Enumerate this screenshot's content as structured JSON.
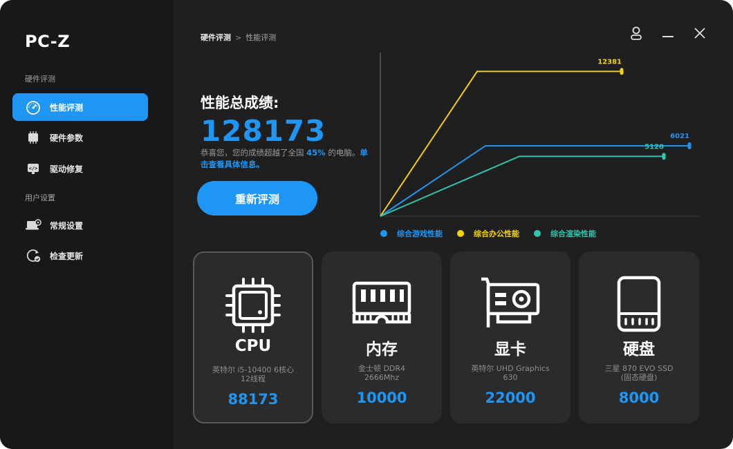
{
  "app": {
    "title": "PC-Z"
  },
  "sidebar": {
    "section_hardware": "硬件评测",
    "section_user": "用户设置",
    "items": [
      {
        "label": "性能评测",
        "icon": "speedometer-icon",
        "active": true
      },
      {
        "label": "硬件参数",
        "icon": "chip-icon",
        "active": false
      },
      {
        "label": "驱动修复",
        "icon": "driver-icon",
        "active": false
      },
      {
        "label": "常规设置",
        "icon": "laptop-settings-icon",
        "active": false
      },
      {
        "label": "检查更新",
        "icon": "refresh-check-icon",
        "active": false
      }
    ]
  },
  "breadcrumb": {
    "level1": "硬件评测",
    "separator": ">",
    "level2": "性能评测"
  },
  "header_icons": [
    "user-icon",
    "minimize-icon",
    "close-icon"
  ],
  "score": {
    "title": "性能总成绩:",
    "value": "128173",
    "desc_prefix": "恭喜您，您的成绩超越了全国 ",
    "percent": "45%",
    "desc_middle": " 的电脑。",
    "desc_link": "单击查看具体信息。",
    "retest_label": "重新评测"
  },
  "colors": {
    "accent": "#1e96f5",
    "office": "#f5d10f",
    "render": "#2ec7b0"
  },
  "chart_data": {
    "type": "line",
    "title": "",
    "xlabel": "",
    "ylabel": "",
    "series": [
      {
        "name": "综合游戏性能",
        "color": "#1e96f5",
        "values": [
          0,
          6021,
          6021
        ],
        "end_label": "6021"
      },
      {
        "name": "综合办公性能",
        "color": "#f5d10f",
        "values": [
          0,
          12381,
          12381
        ],
        "end_label": "12381"
      },
      {
        "name": "综合渲染性能",
        "color": "#2ec7b0",
        "values": [
          0,
          5120,
          5120
        ],
        "end_label": "5120"
      }
    ],
    "ylim": [
      0,
      14000
    ],
    "grid": false,
    "legend": "bottom"
  },
  "cards": [
    {
      "name": "CPU",
      "icon": "cpu-icon",
      "desc_line1": "英特尔 i5-10400 6核心",
      "desc_line2": "12线程",
      "score": "88173",
      "selected": true
    },
    {
      "name": "内存",
      "icon": "memory-icon",
      "desc_line1": "金士顿 DDR4",
      "desc_line2": "2666Mhz",
      "score": "10000",
      "selected": false
    },
    {
      "name": "显卡",
      "icon": "gpu-icon",
      "desc_line1": "英特尔 UHD Graphics",
      "desc_line2": "630",
      "score": "22000",
      "selected": false
    },
    {
      "name": "硬盘",
      "icon": "ssd-icon",
      "desc_line1": "三星 870 EVO SSD",
      "desc_line2": "(固态硬盘)",
      "score": "8000",
      "selected": false
    }
  ]
}
